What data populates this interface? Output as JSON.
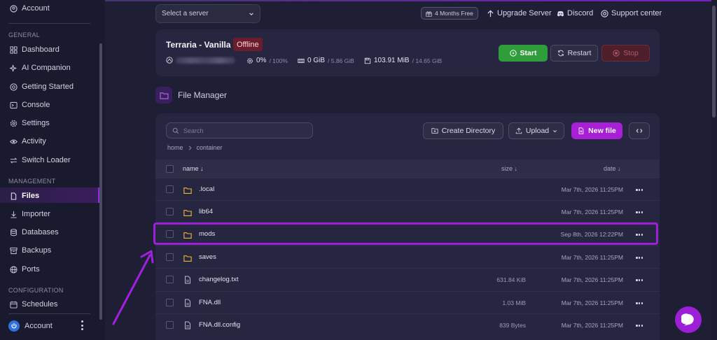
{
  "sidebar": {
    "account_top": "Account",
    "sections": {
      "general": "GENERAL",
      "management": "MANAGEMENT",
      "configuration": "CONFIGURATION"
    },
    "items": [
      {
        "label": "Dashboard",
        "icon": "grid-icon"
      },
      {
        "label": "AI Companion",
        "icon": "sparkle-icon"
      },
      {
        "label": "Getting Started",
        "icon": "compass-icon"
      },
      {
        "label": "Console",
        "icon": "terminal-icon"
      },
      {
        "label": "Settings",
        "icon": "gear-icon"
      },
      {
        "label": "Activity",
        "icon": "eye-icon"
      },
      {
        "label": "Switch Loader",
        "icon": "swap-icon"
      },
      {
        "label": "Files",
        "icon": "file-icon",
        "active": true
      },
      {
        "label": "Importer",
        "icon": "download-icon"
      },
      {
        "label": "Databases",
        "icon": "database-icon"
      },
      {
        "label": "Backups",
        "icon": "archive-icon"
      },
      {
        "label": "Ports",
        "icon": "globe-icon"
      },
      {
        "label": "Schedules",
        "icon": "calendar-icon"
      }
    ],
    "account_bottom": "Account"
  },
  "topbar": {
    "server_select_placeholder": "Select a server",
    "promo": "4 Months Free",
    "links": {
      "upgrade": "Upgrade Server",
      "discord": "Discord",
      "support": "Support center"
    }
  },
  "server": {
    "name": "Terraria - Vanilla",
    "status": "Offline",
    "cpu": "0%",
    "cpu_limit": "/ 100%",
    "memory": "0 GiB",
    "memory_limit": "/ 5.86 GiB",
    "disk": "103.91 MiB",
    "disk_limit": "/ 14.65 GiB",
    "buttons": {
      "start": "Start",
      "restart": "Restart",
      "stop": "Stop"
    }
  },
  "file_manager": {
    "title": "File Manager",
    "search_placeholder": "Search",
    "buttons": {
      "create_dir": "Create Directory",
      "upload": "Upload",
      "new_file": "New file"
    },
    "breadcrumb": [
      "home",
      "container"
    ],
    "columns": {
      "name": "name ↓",
      "size": "size ↓",
      "date": "date ↓"
    },
    "rows": [
      {
        "type": "folder",
        "name": ".local",
        "size": "",
        "date": "Mar 7th, 2026 11:25PM"
      },
      {
        "type": "folder",
        "name": "lib64",
        "size": "",
        "date": "Mar 7th, 2026 11:25PM"
      },
      {
        "type": "folder",
        "name": "mods",
        "size": "",
        "date": "Sep 8th, 2026 12:22PM",
        "highlighted": true
      },
      {
        "type": "folder",
        "name": "saves",
        "size": "",
        "date": "Mar 7th, 2026 11:25PM"
      },
      {
        "type": "file",
        "name": "changelog.txt",
        "size": "631.84 KiB",
        "date": "Mar 7th, 2026 11:25PM"
      },
      {
        "type": "file",
        "name": "FNA.dll",
        "size": "1.03 MiB",
        "date": "Mar 7th, 2026 11:25PM"
      },
      {
        "type": "file",
        "name": "FNA.dll.config",
        "size": "839 Bytes",
        "date": "Mar 7th, 2026 11:25PM"
      }
    ]
  },
  "colors": {
    "accent": "#a820d6",
    "start": "#2f9d3a",
    "offline": "#6a1d2c",
    "folder": "#e9b43a"
  }
}
